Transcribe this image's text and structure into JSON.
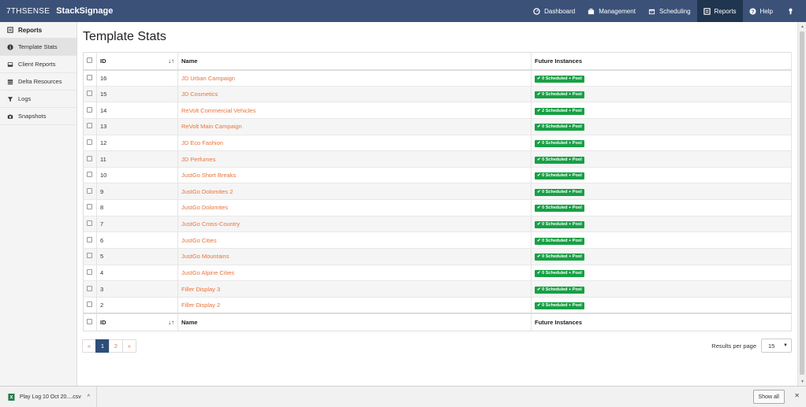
{
  "navbar": {
    "logo": "7THSENSE",
    "app_name": "StackSignage",
    "items": [
      {
        "label": "Dashboard",
        "icon": "dashboard-icon"
      },
      {
        "label": "Management",
        "icon": "briefcase-icon"
      },
      {
        "label": "Scheduling",
        "icon": "calendar-icon"
      },
      {
        "label": "Reports",
        "icon": "report-icon"
      },
      {
        "label": "Help",
        "icon": "help-icon"
      }
    ],
    "user_icon": "user-icon"
  },
  "sidebar": {
    "header": "Reports",
    "items": [
      {
        "label": "Template Stats",
        "icon": "info-icon"
      },
      {
        "label": "Client Reports",
        "icon": "inbox-icon"
      },
      {
        "label": "Delta Resources",
        "icon": "stack-icon"
      },
      {
        "label": "Logs",
        "icon": "filter-icon"
      },
      {
        "label": "Snapshots",
        "icon": "camera-icon"
      }
    ]
  },
  "main": {
    "title": "Template Stats",
    "table": {
      "columns": [
        "ID",
        "Name",
        "Future Instances"
      ],
      "rows": [
        {
          "id": "16",
          "name": "JD Urban Campaign",
          "future": "0 Scheduled + Pool"
        },
        {
          "id": "15",
          "name": "JD Cosmetics",
          "future": "0 Scheduled + Pool"
        },
        {
          "id": "14",
          "name": "ReVolt Commercial Vehicles",
          "future": "2 Scheduled + Pool"
        },
        {
          "id": "13",
          "name": "ReVolt Main Campaign",
          "future": "0 Scheduled + Pool"
        },
        {
          "id": "12",
          "name": "JD Eco Fashion",
          "future": "0 Scheduled + Pool"
        },
        {
          "id": "11",
          "name": "JD Perfumes",
          "future": "0 Scheduled + Pool"
        },
        {
          "id": "10",
          "name": "JustGo Short Breaks",
          "future": "0 Scheduled + Pool"
        },
        {
          "id": "9",
          "name": "JustGo Dolomites 2",
          "future": "0 Scheduled + Pool"
        },
        {
          "id": "8",
          "name": "JustGo Dolomites",
          "future": "0 Scheduled + Pool"
        },
        {
          "id": "7",
          "name": "JustGo Cross-Country",
          "future": "0 Scheduled + Pool"
        },
        {
          "id": "6",
          "name": "JustGo Cities",
          "future": "0 Scheduled + Pool"
        },
        {
          "id": "5",
          "name": "JustGo Mountains",
          "future": "0 Scheduled + Pool"
        },
        {
          "id": "4",
          "name": "JustGo Alpine Cities",
          "future": "0 Scheduled + Pool"
        },
        {
          "id": "3",
          "name": "Filler Display 3",
          "future": "0 Scheduled + Pool"
        },
        {
          "id": "2",
          "name": "Filler Display 2",
          "future": "0 Scheduled + Pool"
        }
      ]
    },
    "pagination": {
      "prev": "«",
      "pages": [
        "1",
        "2"
      ],
      "current": "1",
      "next": "»"
    },
    "results_per_page": {
      "label": "Results per page",
      "value": "15"
    }
  },
  "downloads": {
    "file_name": "Play Log 10 Oct 20....csv",
    "show_all": "Show all",
    "close": "✕"
  },
  "colors": {
    "navbar": "#3b5178",
    "navbar_active": "#203550",
    "link": "#e8733a",
    "badge": "#17a045",
    "page_active": "#2f4d7a"
  }
}
